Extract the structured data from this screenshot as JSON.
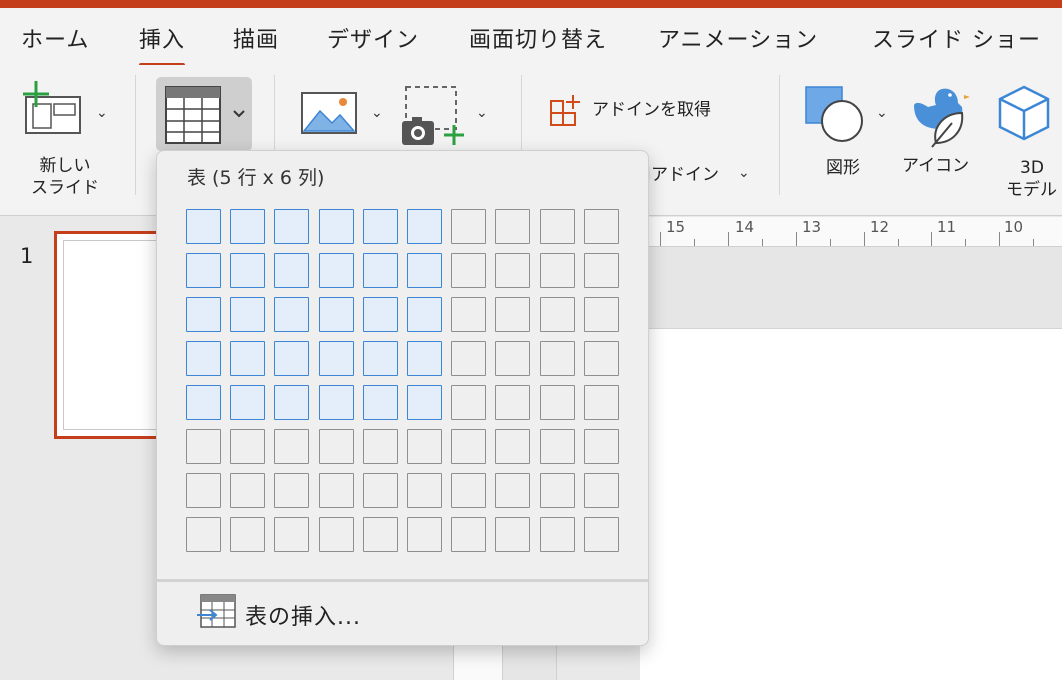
{
  "window": {
    "accent": "#c43e1c"
  },
  "tabs": [
    {
      "label": "ホーム",
      "active": false
    },
    {
      "label": "挿入",
      "active": true
    },
    {
      "label": "描画",
      "active": false
    },
    {
      "label": "デザイン",
      "active": false
    },
    {
      "label": "画面切り替え",
      "active": false
    },
    {
      "label": "アニメーション",
      "active": false
    },
    {
      "label": "スライド ショー",
      "active": false
    }
  ],
  "ribbon": {
    "new_slide": {
      "label_line1": "新しい",
      "label_line2": "スライド",
      "icon": "new-slide-icon"
    },
    "table": {
      "icon": "table-icon"
    },
    "pictures": {
      "icon": "picture-icon"
    },
    "screenshot": {
      "icon": "screenshot-icon"
    },
    "get_addins": {
      "label": "アドインを取得",
      "icon": "addins-icon"
    },
    "my_addins": {
      "label": "個人用アドイン"
    },
    "shapes": {
      "label": "図形",
      "icon": "shapes-icon"
    },
    "icons": {
      "label": "アイコン",
      "icon": "icons-icon"
    },
    "models_3d": {
      "label_line1": "3D",
      "label_line2": "モデル",
      "icon": "cube-icon"
    }
  },
  "table_popup": {
    "title": "表 (5 行 x 6 列)",
    "selected_rows": 5,
    "selected_cols": 6,
    "grid_rows": 8,
    "grid_cols": 10,
    "insert_label": "表の挿入..."
  },
  "slides_pane": {
    "slide_number": "1"
  },
  "ruler": {
    "labels": [
      "15",
      "14",
      "13",
      "12",
      "11",
      "10"
    ]
  }
}
